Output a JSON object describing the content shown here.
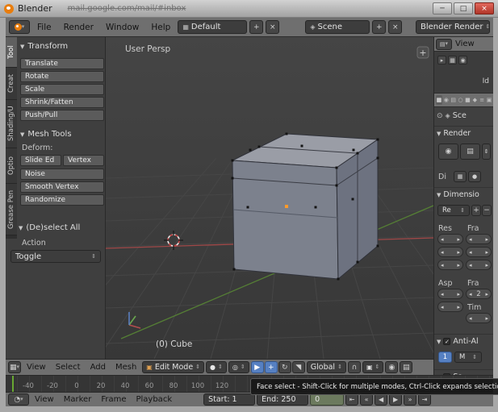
{
  "titlebar": {
    "title": "Blender",
    "ghost_text": "mail.google.com/mail/#inbox",
    "minimize_glyph": "─",
    "maximize_glyph": "□",
    "close_glyph": "×"
  },
  "info_header": {
    "menus": [
      "File",
      "Render",
      "Window",
      "Help"
    ],
    "layout_value": "Default",
    "scene_value": "Scene",
    "engine_value": "Blender Render"
  },
  "tool_shelf": {
    "tabs": [
      "Tool",
      "Creat",
      "Shading/U",
      "Optio",
      "Grease Pen"
    ],
    "transform_title": "Transform",
    "transform_buttons": [
      "Translate",
      "Rotate",
      "Scale",
      "Shrink/Fatten",
      "Push/Pull"
    ],
    "mesh_tools_title": "Mesh Tools",
    "deform_label": "Deform:",
    "deform_row": [
      "Slide Ed",
      "Vertex"
    ],
    "mesh_tools_buttons": [
      "Noise",
      "Smooth Vertex",
      "Randomize"
    ],
    "deselect_title": "(De)select All",
    "action_label": "Action",
    "action_value": "Toggle"
  },
  "viewport": {
    "view_label": "User Persp",
    "object_label": "(0) Cube",
    "add_glyph": "+"
  },
  "view3d_header": {
    "menus": [
      "View",
      "Select",
      "Add",
      "Mesh"
    ],
    "mode_value": "Edit Mode",
    "orientation_value": "Global"
  },
  "outliner": {
    "menu_label": "View",
    "item_label": "Id",
    "icons": [
      "▸",
      "▦",
      "◉"
    ]
  },
  "properties": {
    "breadcrumb": "Sce",
    "tab_icons": [
      "▦",
      "◉",
      "▤",
      "○",
      "■",
      "◆",
      "≡",
      "▣"
    ],
    "render_title": "Render",
    "display_label": "Di",
    "dimensions_title": "Dimensio",
    "preset_label": "Re",
    "res_label": "Res",
    "frame_label": "Fra",
    "aspect_label": "Asp",
    "rate_label": "Fra",
    "rate_value": "2",
    "time_label": "Tim",
    "aa_title": "Anti-Al",
    "aa_samples": "1",
    "aa_filter": "M",
    "sampled_title": "Sa"
  },
  "timeline": {
    "ticks": [
      "-40",
      "-20",
      "0",
      "20",
      "40",
      "60",
      "80",
      "100",
      "120"
    ],
    "menus": [
      "View",
      "Marker",
      "Frame",
      "Playback"
    ],
    "start_value": "Start: 1",
    "end_value": "End: 250",
    "frame_value": "0"
  },
  "tooltip_text": "Face select - Shift-Click for multiple modes, Ctrl-Click expands selection",
  "colors": {
    "accent_selected": "#5680c2",
    "close_button": "#b03528",
    "axis_x": "#a04848",
    "axis_y": "#557f35",
    "active_vertex": "#ff9a2a",
    "playhead_green": "#68a832"
  },
  "glyphs": {
    "dropdown": "▾",
    "updown": "⇕",
    "panel_open": "▼",
    "plus": "+",
    "minus": "−",
    "close": "×",
    "grid": "▦",
    "scene": "◈",
    "cube": "▣",
    "sphere": "●",
    "pivot": "◎",
    "pointer": "▶",
    "move": "+",
    "rotate": "↻",
    "scale": "◥",
    "magnet": "∩",
    "camera": "◉",
    "clip": "▤",
    "clock": "◔",
    "pin": "⊙",
    "check": "✓",
    "stepper_left": "◂",
    "stepper_right": "▸",
    "jump_start": "⇤",
    "prev": "«",
    "play_back": "◀",
    "play": "▶",
    "next": "»",
    "jump_end": "⇥"
  }
}
